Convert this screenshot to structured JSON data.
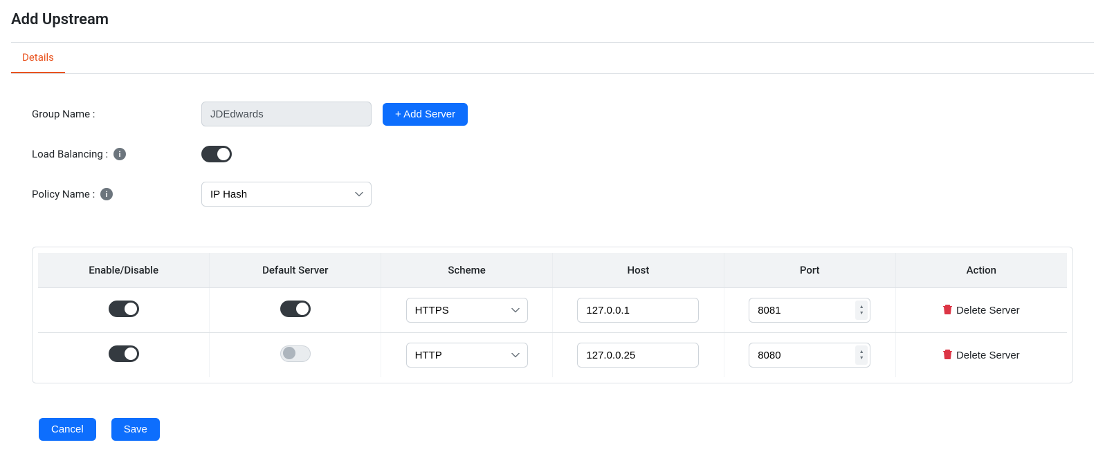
{
  "page_title": "Add Upstream",
  "tab_details": "Details",
  "labels": {
    "group_name": "Group Name :",
    "load_balancing": "Load Balancing :",
    "policy_name": "Policy Name :"
  },
  "form": {
    "group_name_value": "JDEdwards",
    "load_balancing_on": true,
    "policy_value": "IP Hash"
  },
  "buttons": {
    "add_server": "+ Add Server",
    "cancel": "Cancel",
    "save": "Save",
    "delete_server": "Delete Server"
  },
  "table": {
    "headers": {
      "enable": "Enable/Disable",
      "default": "Default Server",
      "scheme": "Scheme",
      "host": "Host",
      "port": "Port",
      "action": "Action"
    },
    "rows": [
      {
        "enabled": true,
        "default": true,
        "scheme": "HTTPS",
        "host": "127.0.0.1",
        "port": "8081"
      },
      {
        "enabled": true,
        "default": false,
        "scheme": "HTTP",
        "host": "127.0.0.25",
        "port": "8080"
      }
    ]
  }
}
